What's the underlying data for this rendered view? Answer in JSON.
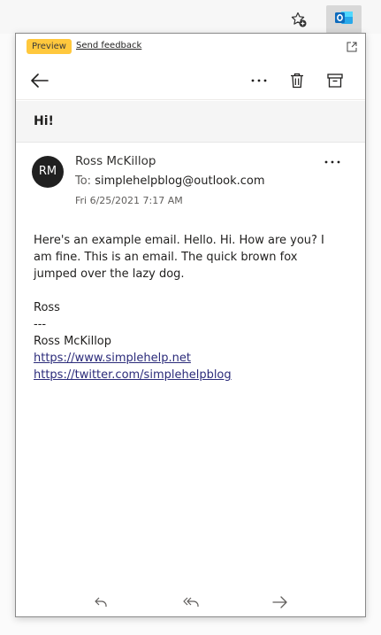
{
  "browser": {
    "favorites_icon": "star-plus-icon",
    "extension_icon": "outlook-icon",
    "outlook_color": "#0f6cbd"
  },
  "popup": {
    "badge": "Preview",
    "badge_color": "#ffc83d",
    "feedback_link": "Send feedback",
    "popout_icon": "popout-icon"
  },
  "toolbar": {
    "back_icon": "arrow-left-icon",
    "more_icon": "more-horizontal-icon",
    "delete_icon": "trash-icon",
    "archive_icon": "archive-icon"
  },
  "message": {
    "subject": "Hi!",
    "avatar_initials": "RM",
    "sender_name": "Ross McKillop",
    "to_label": "To:",
    "to_address": "simplehelpblog@outlook.com",
    "date": "Fri 6/25/2021 7:17 AM",
    "body_paragraph": "Here's an example email. Hello. Hi. How are you? I am fine. This is an email. The quick brown fox jumped over the lazy dog.",
    "signature_lines": [
      "Ross",
      "---",
      "Ross McKillop"
    ],
    "links": [
      "https://www.simplehelp.net",
      "https://twitter.com/simplehelpblog"
    ]
  },
  "bottombar": {
    "reply_icon": "reply-icon",
    "reply_all_icon": "reply-all-icon",
    "forward_icon": "forward-icon"
  }
}
